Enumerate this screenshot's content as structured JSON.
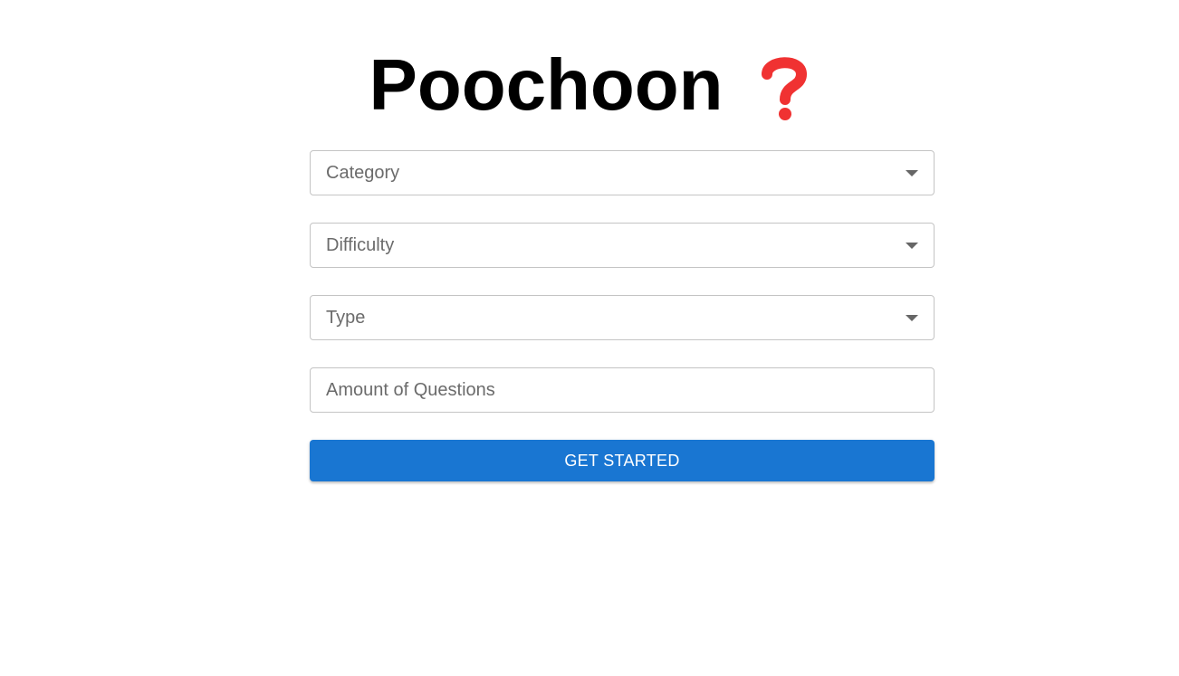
{
  "header": {
    "title": "Poochoon",
    "title_icon": "red-question-mark-icon",
    "icon_color": "#f03232"
  },
  "form": {
    "category": {
      "label": "Category",
      "icon": "chevron-down-icon"
    },
    "difficulty": {
      "label": "Difficulty",
      "icon": "chevron-down-icon"
    },
    "type": {
      "label": "Type",
      "icon": "chevron-down-icon"
    },
    "amount": {
      "placeholder": "Amount of Questions",
      "value": ""
    },
    "submit": {
      "label": "GET STARTED",
      "color": "#1976d2"
    }
  }
}
